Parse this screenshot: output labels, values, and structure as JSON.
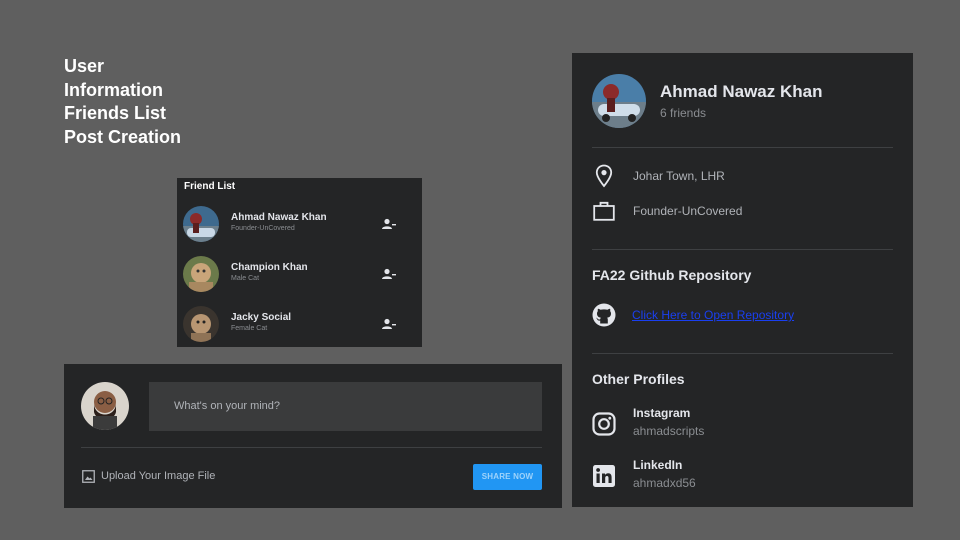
{
  "features": [
    "User",
    "Information",
    "Friends List",
    "Post Creation"
  ],
  "friend_list": {
    "title": "Friend List",
    "friends": [
      {
        "name": "Ahmad Nawaz Khan",
        "subtitle": "Founder-UnCovered"
      },
      {
        "name": "Champion Khan",
        "subtitle": "Male Cat"
      },
      {
        "name": "Jacky Social",
        "subtitle": "Female Cat"
      }
    ]
  },
  "post": {
    "placeholder": "What's on your mind?",
    "upload_label": "Upload Your Image File",
    "share_label": "SHARE NOW"
  },
  "profile": {
    "name": "Ahmad Nawaz Khan",
    "friends_count": "6 friends",
    "location": "Johar Town, LHR",
    "work": "Founder-UnCovered",
    "repo_title": "FA22 Github Repository",
    "repo_link": "Click Here to Open Repository",
    "other_title": "Other Profiles",
    "socials": [
      {
        "network": "Instagram",
        "username": "ahmadscripts",
        "icon": "instagram-icon"
      },
      {
        "network": "LinkedIn",
        "username": "ahmadxd56",
        "icon": "linkedin-icon"
      }
    ]
  },
  "colors": {
    "background": "#5f5f5f",
    "panel": "#242526",
    "input": "#3a3b3c",
    "accent": "#2196f3",
    "link": "#1a3ff0"
  }
}
